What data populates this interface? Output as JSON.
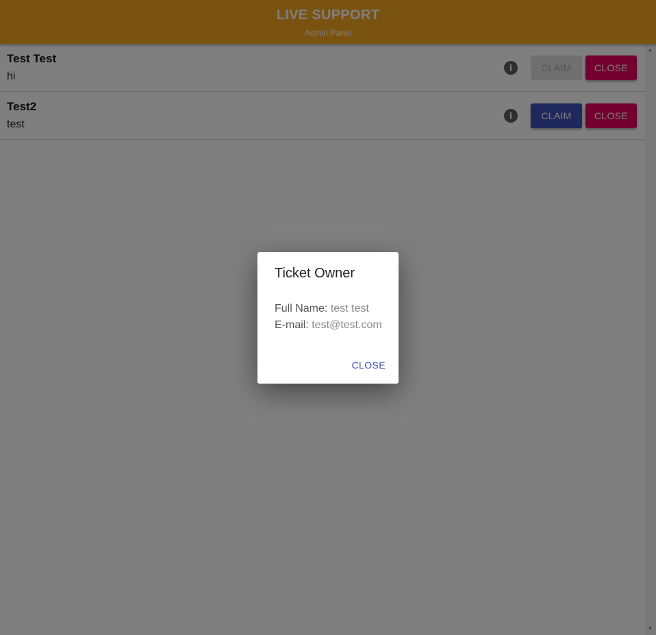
{
  "header": {
    "title": "LIVE SUPPORT",
    "subtitle": "Admin Panel"
  },
  "tickets": [
    {
      "name": "Test Test",
      "message": "hi",
      "claim_label": "CLAIM",
      "claim_disabled": true,
      "close_label": "CLOSE"
    },
    {
      "name": "Test2",
      "message": "test",
      "claim_label": "CLAIM",
      "claim_disabled": false,
      "close_label": "CLOSE"
    }
  ],
  "dialog": {
    "title": "Ticket Owner",
    "full_name_label": "Full Name:",
    "full_name_value": "test test",
    "email_label": "E-mail:",
    "email_value": "test@test.com",
    "close_label": "CLOSE"
  },
  "colors": {
    "header": "#f5a623",
    "claim": "#3f51b5",
    "close": "#e6005c"
  }
}
